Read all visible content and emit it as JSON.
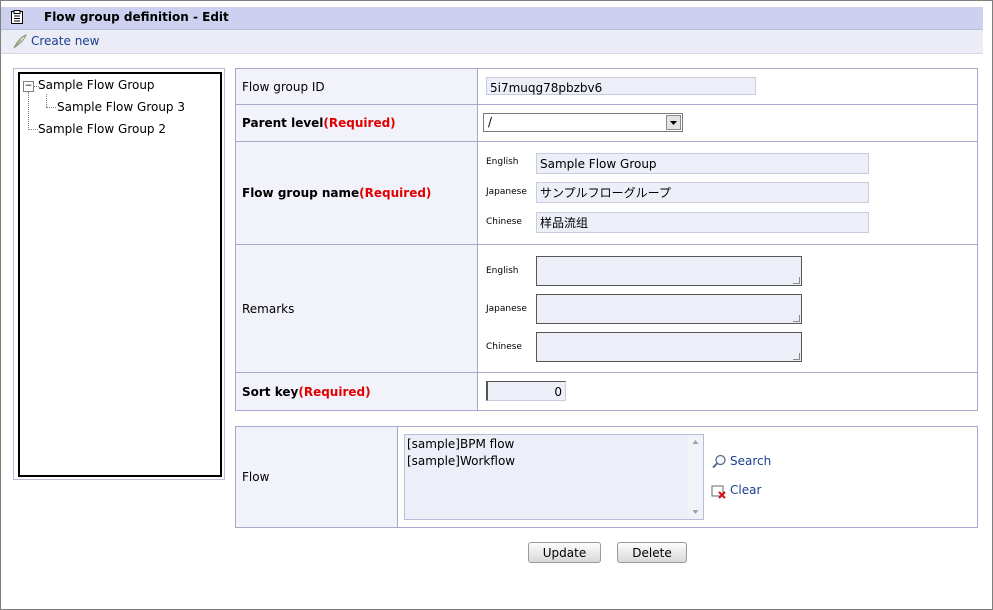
{
  "window": {
    "title": "Flow group definition - Edit"
  },
  "toolbar": {
    "create_new_label": "Create new"
  },
  "tree": {
    "nodes": [
      {
        "label": "Sample Flow Group",
        "toggle": "−"
      },
      {
        "label": "Sample Flow Group 3"
      },
      {
        "label": "Sample Flow Group 2"
      }
    ]
  },
  "form": {
    "flow_group_id": {
      "label": "Flow group ID",
      "value": "5i7muqg78pbzbv6"
    },
    "parent_level": {
      "label": "Parent level",
      "required": "(Required)",
      "value": "/"
    },
    "flow_group_name": {
      "label": "Flow group name",
      "required": "(Required)",
      "english_label": "English",
      "english_value": "Sample Flow Group",
      "japanese_label": "Japanese",
      "japanese_value": "サンプルフローグループ",
      "chinese_label": "Chinese",
      "chinese_value": "样品流组"
    },
    "remarks": {
      "label": "Remarks",
      "english_label": "English",
      "japanese_label": "Japanese",
      "chinese_label": "Chinese",
      "english_value": "",
      "japanese_value": "",
      "chinese_value": ""
    },
    "sort_key": {
      "label": "Sort key",
      "required": "(Required)",
      "value": "0"
    }
  },
  "flow": {
    "label": "Flow",
    "items": [
      "[sample]BPM flow",
      "[sample]Workflow"
    ],
    "search_label": "Search",
    "clear_label": "Clear"
  },
  "actions": {
    "update_label": "Update",
    "delete_label": "Delete"
  }
}
